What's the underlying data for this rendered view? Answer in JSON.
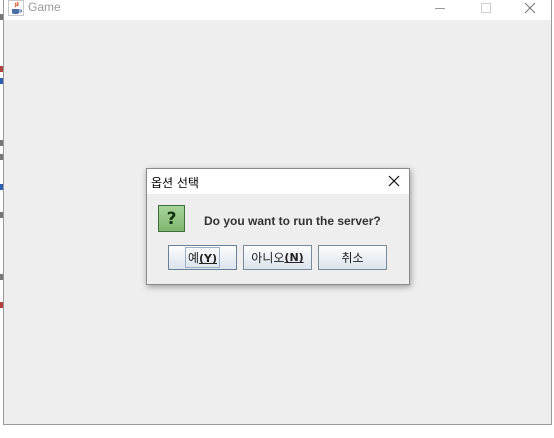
{
  "window": {
    "title": "Game",
    "controls": {
      "minimize_icon": "minimize-icon",
      "maximize_icon": "maximize-icon",
      "close_icon": "close-icon"
    }
  },
  "dialog": {
    "title": "옵션 선택",
    "icon": "question-icon",
    "icon_glyph": "?",
    "message": "Do you want to run the server?",
    "buttons": [
      {
        "label": "예",
        "mnemonic": "(Y)",
        "focused": true
      },
      {
        "label": "아니오",
        "mnemonic": "(N)",
        "focused": false
      },
      {
        "label": "취소",
        "mnemonic": "",
        "focused": false
      }
    ]
  },
  "colors": {
    "window_bg": "#eeeeee",
    "button_border": "#7a8a99",
    "question_icon_bg": "#8fc47f"
  }
}
